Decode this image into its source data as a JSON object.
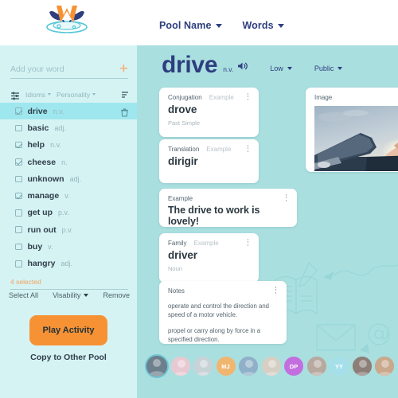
{
  "app": {
    "logo_name": "wordpool-logo"
  },
  "topnav": {
    "items": [
      {
        "label": "Pool Name",
        "name": "nav-pool-name"
      },
      {
        "label": "Words",
        "name": "nav-words"
      }
    ]
  },
  "sidebar": {
    "add_input": {
      "placeholder": "Add your word",
      "value": "",
      "add_label": "+"
    },
    "filters": [
      {
        "label": "Idioms"
      },
      {
        "label": "Personality"
      }
    ],
    "words": [
      {
        "label": "drive",
        "pos": "n.v.",
        "checked": true,
        "selected": true
      },
      {
        "label": "basic",
        "pos": "adj.",
        "checked": false,
        "selected": false
      },
      {
        "label": "help",
        "pos": "n.v.",
        "checked": true,
        "selected": false
      },
      {
        "label": "cheese",
        "pos": "n.",
        "checked": true,
        "selected": false
      },
      {
        "label": "unknown",
        "pos": "adj.",
        "checked": false,
        "selected": false
      },
      {
        "label": "manage",
        "pos": "v.",
        "checked": true,
        "selected": false
      },
      {
        "label": "get up",
        "pos": "p.v.",
        "checked": false,
        "selected": false
      },
      {
        "label": "run out",
        "pos": "p.v.",
        "checked": false,
        "selected": false
      },
      {
        "label": "buy",
        "pos": "v.",
        "checked": false,
        "selected": false
      },
      {
        "label": "hangry",
        "pos": "adj.",
        "checked": false,
        "selected": false
      }
    ],
    "selected_count_text": "4 selected",
    "select_all_label": "Select All",
    "visibility_label": "Visability",
    "remove_label": "Remove",
    "play_button_label": "Play Activity",
    "copy_link_label": "Copy to Other Pool"
  },
  "word_header": {
    "word": "drive",
    "pos": "n.v.",
    "level_label": "Low",
    "visibility_label": "Public"
  },
  "cards": [
    {
      "name": "conjugation-card",
      "label": "Conjugation",
      "secondary_label": "Example",
      "value": "drove",
      "sub": "Past Simple"
    },
    {
      "name": "translation-card",
      "label": "Translation",
      "secondary_label": "Example",
      "value": "dirigir",
      "sub": ""
    },
    {
      "name": "example-card",
      "label": "Example",
      "secondary_label": "",
      "value": "The drive to work is lovely!",
      "sub": ""
    },
    {
      "name": "family-card",
      "label": "Family",
      "secondary_label": "Example",
      "value": "driver",
      "sub": "Noun"
    }
  ],
  "notes_card": {
    "label": "Notes",
    "paragraph1": "operate and control the direction and speed of a motor vehicle.",
    "paragraph2": "propel or carry along by force in a specified direction."
  },
  "image_card": {
    "label": "Image",
    "alt": "person driving a convertible into the sun"
  },
  "avatars": [
    {
      "initials": "",
      "color": "#6d7f8c",
      "active": true
    },
    {
      "initials": "",
      "color": "#e8c9d2",
      "active": false
    },
    {
      "initials": "",
      "color": "#c8d3d8",
      "active": false
    },
    {
      "initials": "MJ",
      "color": "#f0b670",
      "active": false
    },
    {
      "initials": "",
      "color": "#8fb0c8",
      "active": false
    },
    {
      "initials": "",
      "color": "#d6cfc4",
      "active": false
    },
    {
      "initials": "DP",
      "color": "#c36ede",
      "active": false
    },
    {
      "initials": "",
      "color": "#b8a9a0",
      "active": false
    },
    {
      "initials": "YY",
      "color": "#a5e0ea",
      "active": false
    },
    {
      "initials": "",
      "color": "#8c7f78",
      "active": false
    },
    {
      "initials": "",
      "color": "#c9a88c",
      "active": false
    }
  ],
  "colors": {
    "brand_navy": "#2e3e7e",
    "accent_orange": "#f79234",
    "sidebar_bg": "#d6f3f4",
    "main_bg": "#aadfe0",
    "selected_row": "#9fe7ee"
  }
}
